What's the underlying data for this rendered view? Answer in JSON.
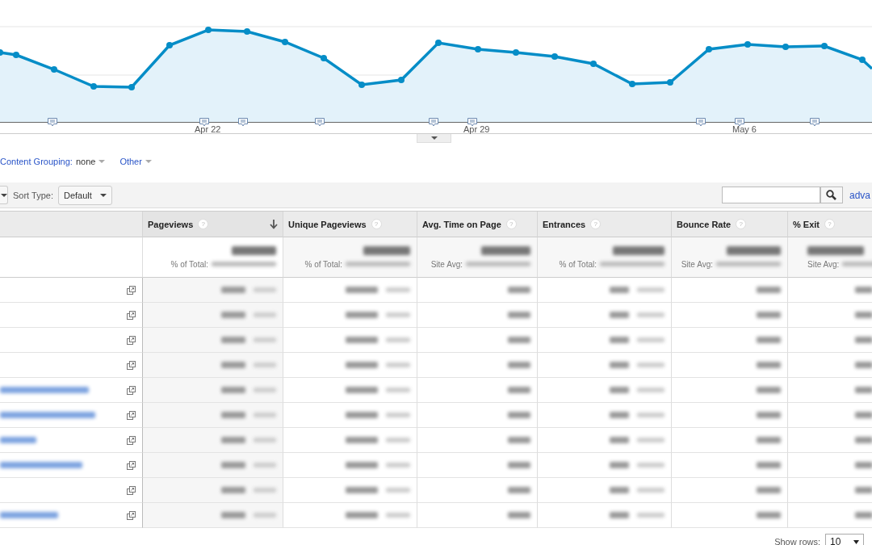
{
  "chart": {
    "x_labels": [
      "Apr 22",
      "Apr 29",
      "May 6"
    ]
  },
  "grouping": {
    "label": "Content Grouping:",
    "value": "none",
    "other": "Other"
  },
  "toolbar": {
    "sort_label": "Sort Type:",
    "sort_value": "Default",
    "advanced": "adva"
  },
  "table": {
    "columns": [
      {
        "label": "Pageviews",
        "help": "?",
        "sorted": true,
        "total_label": "% of Total:"
      },
      {
        "label": "Unique Pageviews",
        "help": "?",
        "sorted": false,
        "total_label": "% of Total:"
      },
      {
        "label": "Avg. Time on Page",
        "help": "?",
        "sorted": false,
        "total_label": "Site Avg:"
      },
      {
        "label": "Entrances",
        "help": "?",
        "sorted": false,
        "total_label": "% of Total:"
      },
      {
        "label": "Bounce Rate",
        "help": "?",
        "sorted": false,
        "total_label": "Site Avg:"
      },
      {
        "label": "% Exit",
        "help": "?",
        "sorted": false,
        "total_label": "Site Avg:"
      }
    ],
    "rows": [
      {
        "has_link": false
      },
      {
        "has_link": false
      },
      {
        "has_link": false
      },
      {
        "has_link": false
      },
      {
        "has_link": true
      },
      {
        "has_link": true
      },
      {
        "has_link": true
      },
      {
        "has_link": true
      },
      {
        "has_link": false
      },
      {
        "has_link": true
      }
    ]
  },
  "footer": {
    "show_rows_label": "Show rows:",
    "show_rows_value": "10"
  }
}
